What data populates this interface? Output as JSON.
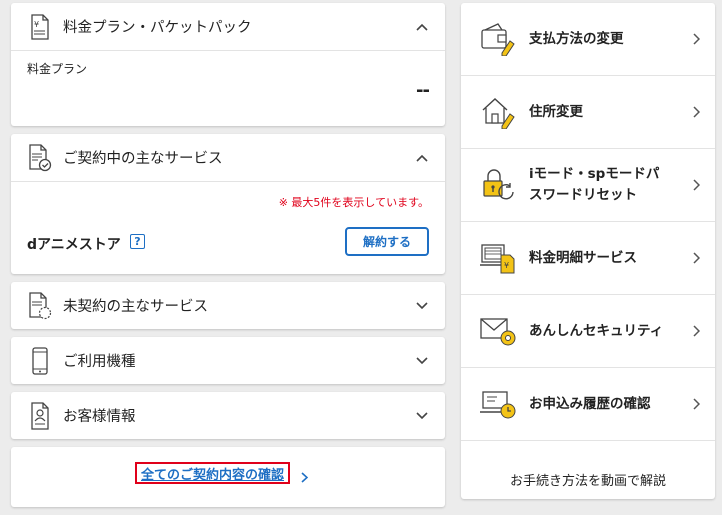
{
  "plan": {
    "title": "料金プラン・パケットパック",
    "label": "料金プラン",
    "value": "--"
  },
  "contracted": {
    "title": "ご契約中の主なサービス",
    "note": "※ 最大5件を表示しています。",
    "service_name": "dアニメストア",
    "help": "?",
    "cancel_label": "解約する"
  },
  "uncontracted": {
    "title": "未契約の主なサービス"
  },
  "device": {
    "title": "ご利用機種"
  },
  "customer": {
    "title": "お客様情報"
  },
  "all_link": "全てのご契約内容の確認",
  "menu": [
    {
      "label": "支払方法の変更",
      "icon": "wallet-icon"
    },
    {
      "label": "住所変更",
      "icon": "house-icon"
    },
    {
      "label": "iモード・spモードパスワードリセット",
      "line1": "iモード・spモードパ",
      "line2": "スワードリセット",
      "icon": "lock-reset-icon"
    },
    {
      "label": "料金明細サービス",
      "icon": "bill-icon"
    },
    {
      "label": "あんしんセキュリティ",
      "icon": "mail-security-icon"
    },
    {
      "label": "お申込み履歴の確認",
      "icon": "history-icon"
    }
  ],
  "video_help": "お手続き方法を動画で解説",
  "colors": {
    "accent": "#1e6fc4",
    "alert": "#e0001a",
    "icon_yellow": "#f3c316"
  }
}
